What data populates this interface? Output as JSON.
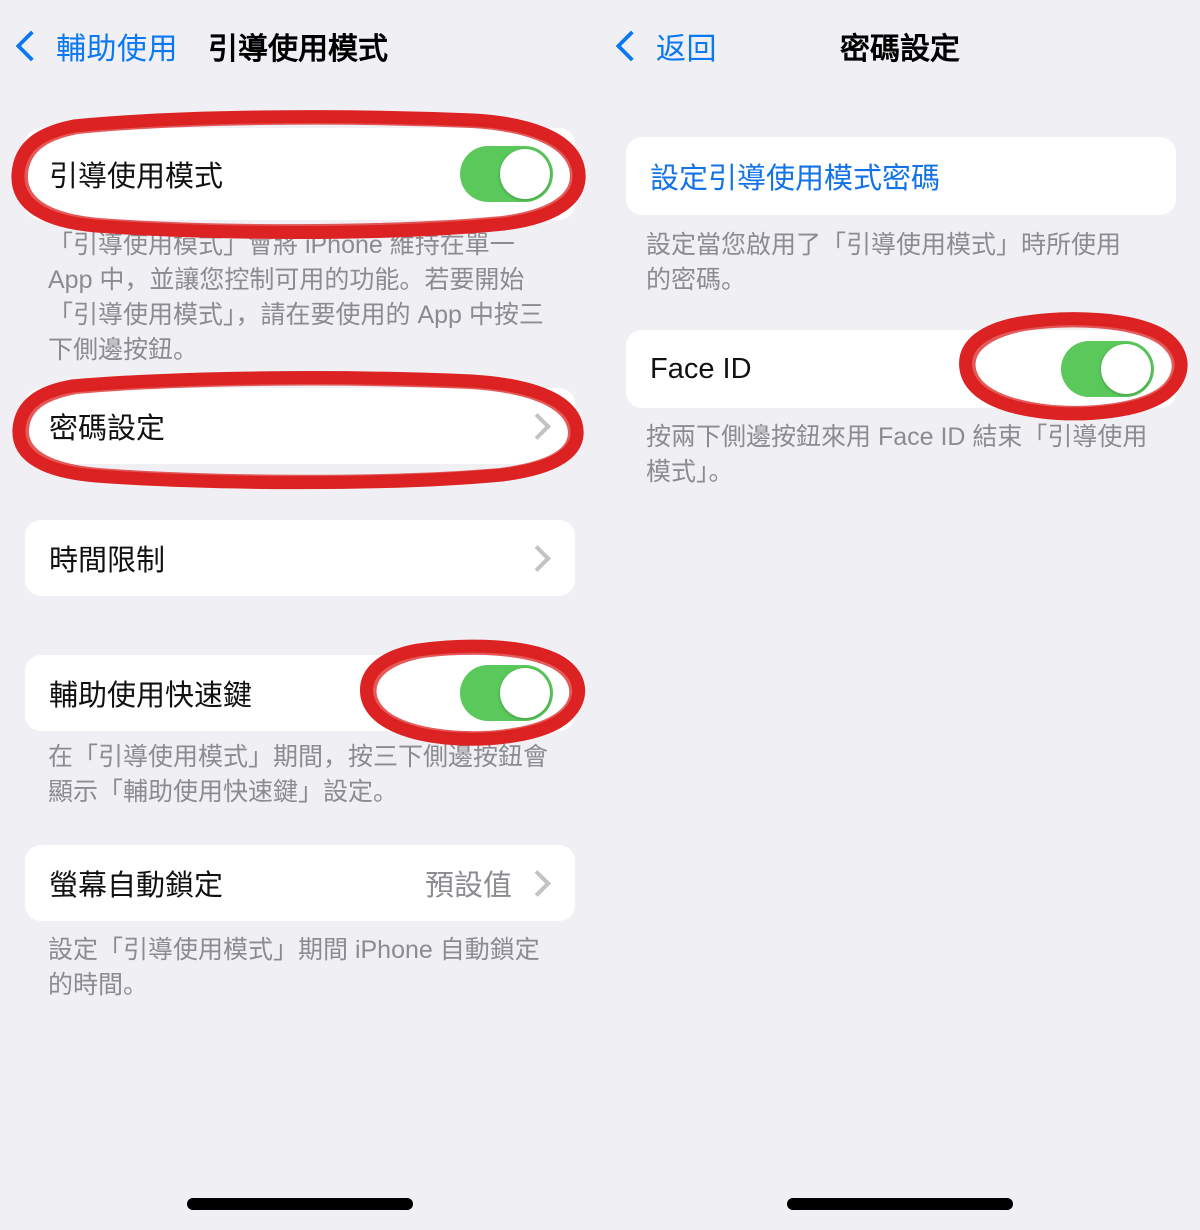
{
  "left_pane": {
    "nav": {
      "back_label": "輔助使用",
      "back_icon": "chevron-left-icon",
      "title": "引導使用模式"
    },
    "sections": [
      {
        "rows": [
          {
            "label": "引導使用模式",
            "control": "toggle",
            "toggle_on": true,
            "highlighted": true
          }
        ],
        "footer": "「引導使用模式」會將 iPhone 維持在單一\nApp 中，並讓您控制可用的功能。若要開始\n「引導使用模式」，請在要使用的 App 中按三\n下側邊按鈕。"
      },
      {
        "rows": [
          {
            "label": "密碼設定",
            "control": "chevron",
            "highlighted": true
          }
        ],
        "footer": ""
      },
      {
        "rows": [
          {
            "label": "時間限制",
            "control": "chevron",
            "highlighted": false
          }
        ],
        "footer": ""
      },
      {
        "rows": [
          {
            "label": "輔助使用快速鍵",
            "control": "toggle",
            "toggle_on": true,
            "highlighted": true
          }
        ],
        "footer": "在「引導使用模式」期間，按三下側邊按鈕會\n顯示「輔助使用快速鍵」設定。"
      },
      {
        "rows": [
          {
            "label": "螢幕自動鎖定",
            "value": "預設值",
            "control": "chevron",
            "highlighted": false
          }
        ],
        "footer": "設定「引導使用模式」期間 iPhone 自動鎖定\n的時間。"
      }
    ]
  },
  "right_pane": {
    "nav": {
      "back_label": "返回",
      "back_icon": "chevron-left-icon",
      "title": "密碼設定"
    },
    "sections": [
      {
        "rows": [
          {
            "label": "設定引導使用模式密碼",
            "control": "none",
            "link": true,
            "highlighted": false
          }
        ],
        "footer": "設定當您啟用了「引導使用模式」時所使用\n的密碼。"
      },
      {
        "rows": [
          {
            "label": "Face ID",
            "control": "toggle",
            "toggle_on": true,
            "highlighted": true
          }
        ],
        "footer": "按兩下側邊按鈕來用 Face ID 結束「引導使用\n模式」。"
      }
    ]
  },
  "colors": {
    "background": "#f0f0f4",
    "card": "#ffffff",
    "accent_blue": "#0a78f0",
    "link_blue": "#1272e8",
    "toggle_on_green": "#5ac85a",
    "annotation_red": "#dc2222",
    "footer_gray": "#8b8b91",
    "chevron_gray": "#c2c2c7"
  },
  "annotations": {
    "color": "#dc2222",
    "shapes": [
      {
        "name": "guided-access-row-circle",
        "target": "引導使用模式"
      },
      {
        "name": "passcode-settings-row-circle",
        "target": "密碼設定"
      },
      {
        "name": "accessibility-shortcut-toggle-circle",
        "target": "輔助使用快速鍵"
      },
      {
        "name": "face-id-toggle-circle",
        "target": "Face ID"
      }
    ]
  }
}
